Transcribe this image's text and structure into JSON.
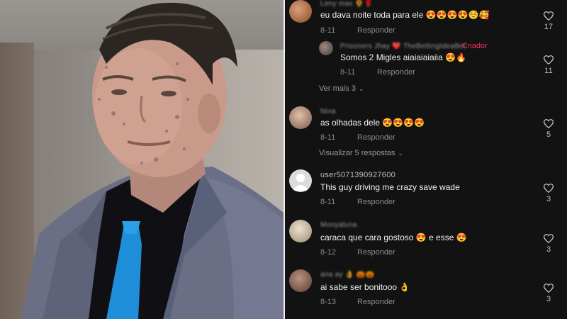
{
  "comments": [
    {
      "username": "Leny mas 🌻🌹",
      "text": "eu dava noite toda para ele 😍😍😍😍☺️🥰",
      "date": "8-11",
      "reply_label": "Responder",
      "likes": "17"
    },
    {
      "username": "Prisoners Jhay ❤️ TheBettingIdeaBet",
      "creator_tag": "· Criador",
      "text": "Somos 2 Migles aiaiaiaiaiia 😍🔥",
      "date": "8-11",
      "reply_label": "Responder",
      "likes": "11"
    },
    {
      "username": "Nina",
      "text": "as olhadas dele 😍😍😍😍",
      "date": "8-11",
      "reply_label": "Responder",
      "likes": "5"
    },
    {
      "username": "user5071390927600",
      "text": "This guy driving me crazy save wade",
      "date": "8-11",
      "reply_label": "Responder",
      "likes": "3"
    },
    {
      "username": "Monyaluna",
      "text": "caraca que cara gostoso 😍 e esse 😍",
      "date": "8-12",
      "reply_label": "Responder",
      "likes": "3"
    },
    {
      "username": "ana ay 👌 🎃🎃",
      "text": "ai sabe ser bonitooo 👌",
      "date": "8-13",
      "reply_label": "Responder",
      "likes": "3"
    }
  ],
  "view_more_1": "Ver mais 3",
  "view_more_2": "Visualizar 5 respostas",
  "colors": {
    "panel_bg": "#121212",
    "creator": "#fe2c55",
    "muted": "#8a8a8a"
  },
  "icons": [
    "heart-icon",
    "chevron-down-icon",
    "default-avatar-icon"
  ]
}
